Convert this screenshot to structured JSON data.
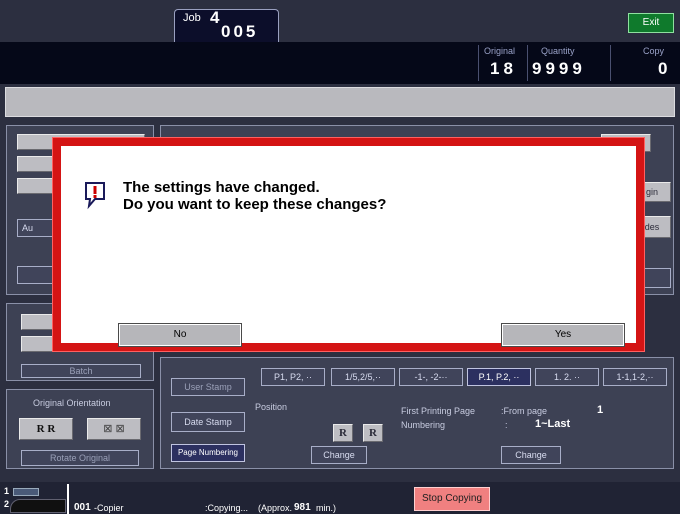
{
  "header": {
    "job_label": "Job",
    "job_number": "4",
    "job_id": "005",
    "exit_label": "Exit"
  },
  "counters": {
    "original_label": "Original",
    "original_value": "18",
    "quantity_label": "Quantity",
    "quantity_value": "9999",
    "copy_label": "Copy",
    "copy_value": "0"
  },
  "dialog": {
    "line1": "The settings have changed.",
    "line2": "Do you want to keep these changes?",
    "no_label": "No",
    "yes_label": "Yes"
  },
  "background": {
    "partial_left": [
      "Au",
      "Batch"
    ],
    "partial_right": [
      "gin",
      "des"
    ],
    "stamp_buttons": [
      "User Stamp",
      "Date Stamp",
      "Page Numbering"
    ],
    "numbering_options": [
      "P1, P2, ··",
      "1/5,2/5,··",
      "-1-, -2-··",
      "P.1, P.2, ··",
      "1. 2. ··",
      "1-1,1-2,··"
    ],
    "position_label": "Position",
    "change_label": "Change",
    "first_printing_page_label": "First Printing Page",
    "from_page_label": ":From  page",
    "from_page_value": "1",
    "numbering_label": "Numbering",
    "numbering_colon": ":",
    "numbering_range": "1~Last",
    "original_orientation_label": "Original Orientation",
    "rotate_original_label": "Rotate Original"
  },
  "footer": {
    "line1": "1",
    "line2": "2",
    "queue_id": "001",
    "queue_mode": "-Copier",
    "status_prefix": ":Copying...",
    "status_approx": "(Approx.",
    "status_minutes": "981",
    "status_suffix": "min.)",
    "stop_label": "Stop Copying"
  }
}
